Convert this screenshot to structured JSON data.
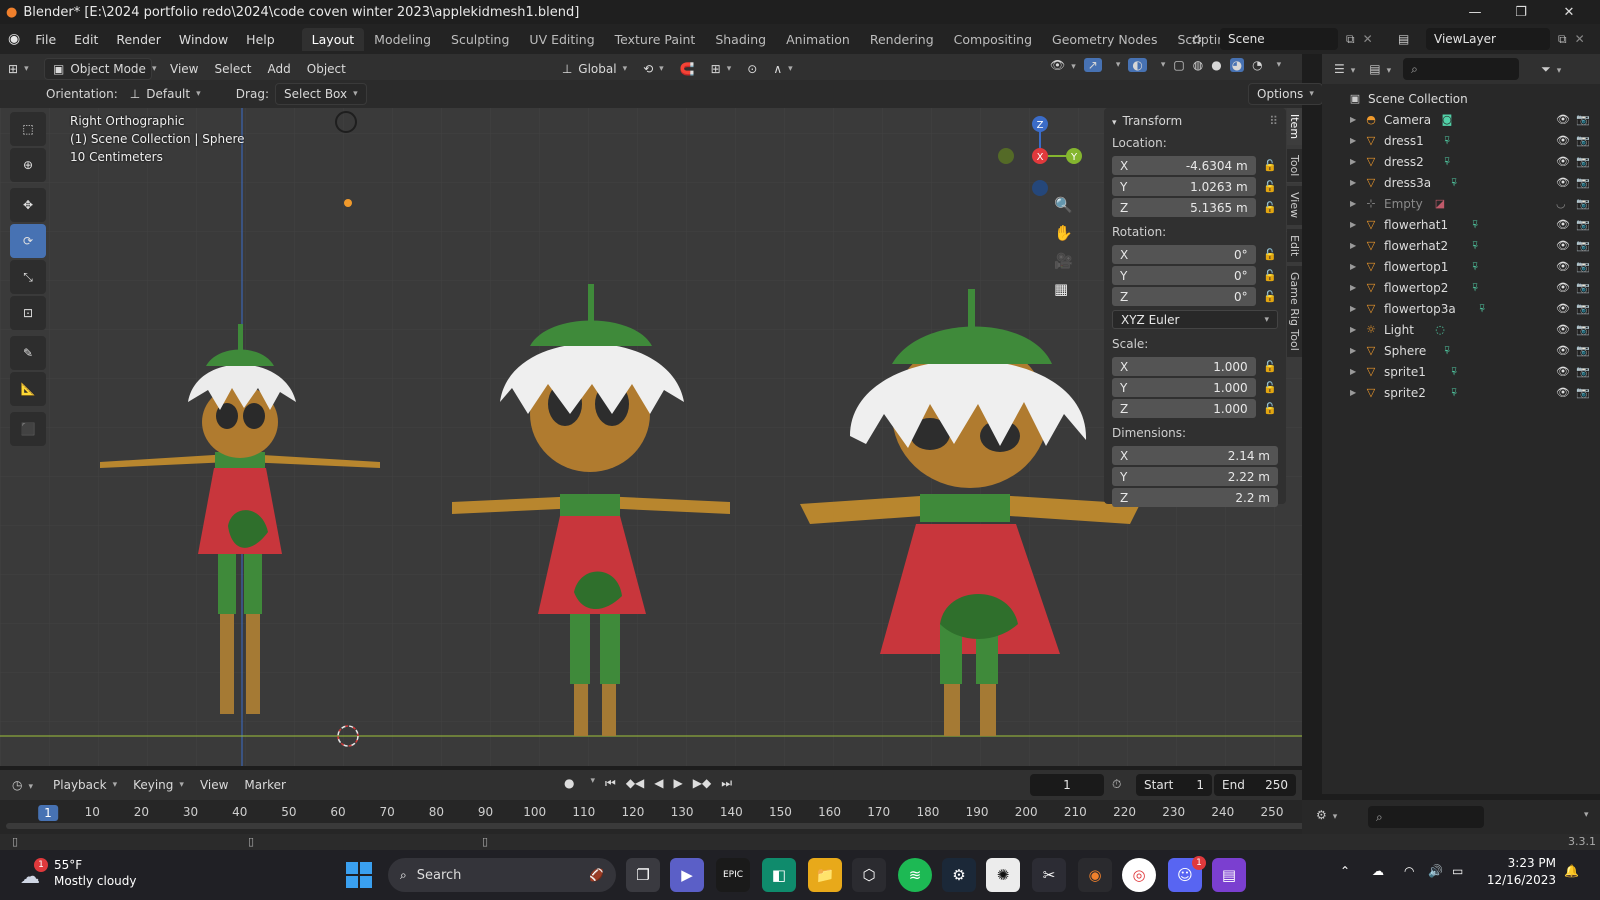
{
  "window": {
    "title": "Blender* [E:\\2024 portfolio redo\\2024\\code coven winter 2023\\applekidmesh1.blend]",
    "controls": [
      "—",
      "❐",
      "✕"
    ]
  },
  "menubar": {
    "menus": [
      "File",
      "Edit",
      "Render",
      "Window",
      "Help"
    ],
    "workspaces": [
      "Layout",
      "Modeling",
      "Sculpting",
      "UV Editing",
      "Texture Paint",
      "Shading",
      "Animation",
      "Rendering",
      "Compositing",
      "Geometry Nodes",
      "Scripting"
    ],
    "active_workspace": "Layout",
    "add_tab": "+",
    "scene": "Scene",
    "view_layer": "ViewLayer"
  },
  "viewport_header": {
    "mode": "Object Mode",
    "menus": [
      "View",
      "Select",
      "Add",
      "Object"
    ],
    "transform_orientation": "Global",
    "orientation_label": "Orientation:",
    "orientation_value": "Default",
    "drag_label": "Drag:",
    "drag_value": "Select Box",
    "options_label": "Options"
  },
  "viewport": {
    "view_name": "Right Orthographic",
    "collection_info": "(1) Scene Collection | Sphere",
    "scale_info": "10 Centimeters",
    "gizmo": {
      "x": "X",
      "y": "Y",
      "z": "Z"
    },
    "colors": {
      "background": "#3a3a3a",
      "grid": "#424242",
      "x_axis": "#9ec23a",
      "z_axis": "#3b6cc8"
    }
  },
  "n_panel": {
    "header": "Transform",
    "tabs": [
      "Item",
      "Tool",
      "View",
      "Edit",
      "Game Rig Tool"
    ],
    "active_tab": "Item",
    "location_label": "Location:",
    "location": [
      {
        "axis": "X",
        "value": "-4.6304 m"
      },
      {
        "axis": "Y",
        "value": "1.0263 m"
      },
      {
        "axis": "Z",
        "value": "5.1365 m"
      }
    ],
    "rotation_label": "Rotation:",
    "rotation": [
      {
        "axis": "X",
        "value": "0°"
      },
      {
        "axis": "Y",
        "value": "0°"
      },
      {
        "axis": "Z",
        "value": "0°"
      }
    ],
    "rotation_mode": "XYZ Euler",
    "scale_label": "Scale:",
    "scale": [
      {
        "axis": "X",
        "value": "1.000"
      },
      {
        "axis": "Y",
        "value": "1.000"
      },
      {
        "axis": "Z",
        "value": "1.000"
      }
    ],
    "dimensions_label": "Dimensions:",
    "dimensions": [
      {
        "axis": "X",
        "value": "2.14 m"
      },
      {
        "axis": "Y",
        "value": "2.22 m"
      },
      {
        "axis": "Z",
        "value": "2.2 m"
      }
    ]
  },
  "outliner": {
    "root": "Scene Collection",
    "items": [
      {
        "label": "Camera",
        "icon": "camera-icon"
      },
      {
        "label": "dress1",
        "icon": "mesh-icon"
      },
      {
        "label": "dress2",
        "icon": "mesh-icon"
      },
      {
        "label": "dress3a",
        "icon": "mesh-icon"
      },
      {
        "label": "Empty",
        "icon": "empty-icon"
      },
      {
        "label": "flowerhat1",
        "icon": "mesh-icon"
      },
      {
        "label": "flowerhat2",
        "icon": "mesh-icon"
      },
      {
        "label": "flowertop1",
        "icon": "mesh-icon"
      },
      {
        "label": "flowertop2",
        "icon": "mesh-icon"
      },
      {
        "label": "flowertop3a",
        "icon": "mesh-icon"
      },
      {
        "label": "Light",
        "icon": "light-icon"
      },
      {
        "label": "Sphere",
        "icon": "mesh-icon"
      },
      {
        "label": "sprite1",
        "icon": "mesh-icon"
      },
      {
        "label": "sprite2",
        "icon": "mesh-icon"
      }
    ]
  },
  "timeline": {
    "menus": [
      "Playback",
      "Keying",
      "View",
      "Marker"
    ],
    "current_frame": "1",
    "start_label": "Start",
    "start": "1",
    "end_label": "End",
    "end": "250",
    "ruler": [
      "1",
      "10",
      "20",
      "30",
      "40",
      "50",
      "60",
      "70",
      "80",
      "90",
      "100",
      "110",
      "120",
      "130",
      "140",
      "150",
      "160",
      "170",
      "180",
      "190",
      "200",
      "210",
      "220",
      "230",
      "240",
      "250"
    ]
  },
  "status_bar": {
    "version": "3.3.1"
  },
  "taskbar": {
    "weather_temp": "55°F",
    "weather_desc": "Mostly cloudy",
    "weather_badge": "1",
    "search": "Search",
    "time": "3:23 PM",
    "date": "12/16/2023",
    "discord_badge": "1",
    "epic_label": "EPIC"
  }
}
